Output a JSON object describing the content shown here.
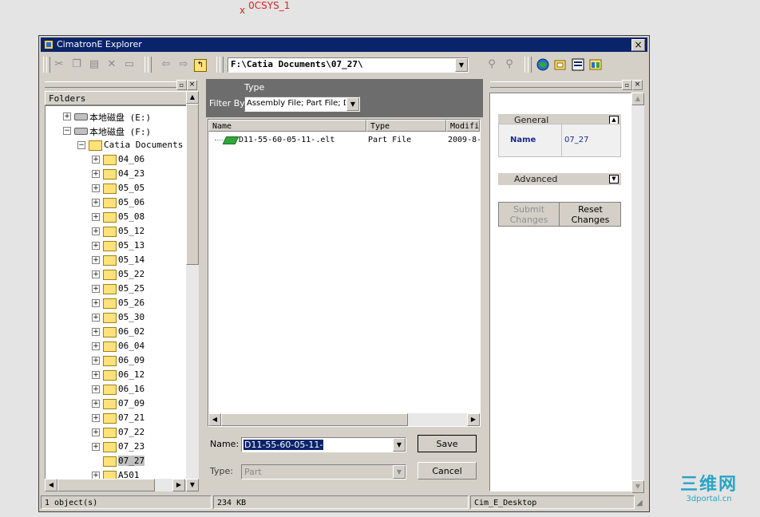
{
  "sketch_label": "0CSYS_1",
  "window": {
    "title": "CimatronE Explorer",
    "close": "×"
  },
  "toolbar": {
    "path": "F:\\Catia Documents\\07_27\\",
    "buttons": [
      "cut-icon",
      "copy-icon",
      "paste-icon",
      "delete-icon",
      "new-folder-icon",
      "back-icon",
      "forward-icon",
      "up-folder-icon",
      "find-icon",
      "find-next-icon",
      "globe-icon",
      "folder-view-icon",
      "properties-icon",
      "layout-icon"
    ]
  },
  "folders": {
    "header": "Folders",
    "items": [
      {
        "label": "本地磁盘 (E:)",
        "expander": "+",
        "type": "drive",
        "depth": 1
      },
      {
        "label": "本地磁盘 (F:)",
        "expander": "−",
        "type": "drive",
        "depth": 1
      },
      {
        "label": "Catia Documents",
        "expander": "−",
        "type": "folder",
        "depth": 2
      },
      {
        "label": "04_06",
        "expander": "+",
        "type": "folder",
        "depth": 3
      },
      {
        "label": "04_23",
        "expander": "+",
        "type": "folder",
        "depth": 3
      },
      {
        "label": "05_05",
        "expander": "+",
        "type": "folder",
        "depth": 3
      },
      {
        "label": "05_06",
        "expander": "+",
        "type": "folder",
        "depth": 3
      },
      {
        "label": "05_08",
        "expander": "+",
        "type": "folder",
        "depth": 3
      },
      {
        "label": "05_12",
        "expander": "+",
        "type": "folder",
        "depth": 3
      },
      {
        "label": "05_13",
        "expander": "+",
        "type": "folder",
        "depth": 3
      },
      {
        "label": "05_14",
        "expander": "+",
        "type": "folder",
        "depth": 3
      },
      {
        "label": "05_22",
        "expander": "+",
        "type": "folder",
        "depth": 3
      },
      {
        "label": "05_25",
        "expander": "+",
        "type": "folder",
        "depth": 3
      },
      {
        "label": "05_26",
        "expander": "+",
        "type": "folder",
        "depth": 3
      },
      {
        "label": "05_30",
        "expander": "+",
        "type": "folder",
        "depth": 3
      },
      {
        "label": "06_02",
        "expander": "+",
        "type": "folder",
        "depth": 3
      },
      {
        "label": "06_04",
        "expander": "+",
        "type": "folder",
        "depth": 3
      },
      {
        "label": "06_09",
        "expander": "+",
        "type": "folder",
        "depth": 3
      },
      {
        "label": "06_12",
        "expander": "+",
        "type": "folder",
        "depth": 3
      },
      {
        "label": "06_16",
        "expander": "+",
        "type": "folder",
        "depth": 3
      },
      {
        "label": "07_09",
        "expander": "+",
        "type": "folder",
        "depth": 3
      },
      {
        "label": "07_21",
        "expander": "+",
        "type": "folder",
        "depth": 3
      },
      {
        "label": "07_22",
        "expander": "+",
        "type": "folder",
        "depth": 3
      },
      {
        "label": "07_23",
        "expander": "+",
        "type": "folder",
        "depth": 3
      },
      {
        "label": "07_27",
        "expander": "",
        "type": "folder",
        "depth": 3,
        "selected": true
      },
      {
        "label": "A501",
        "expander": "+",
        "type": "folder",
        "depth": 3
      }
    ]
  },
  "center": {
    "type_heading": "Type",
    "filter_label": "Filter By:",
    "filter_value": "Assembly File; Part File; Dr",
    "columns": [
      "Name",
      "Type",
      "Modifi"
    ],
    "files": [
      {
        "name": "D11-55-60-05-11-.elt",
        "type": "Part File",
        "modified": "2009-8-"
      }
    ],
    "name_label": "Name:",
    "name_value": "D11-55-60-05-11-",
    "save_label": "Save",
    "type_label": "Type:",
    "type_value": "Part",
    "cancel_label": "Cancel"
  },
  "props": {
    "general_title": "General",
    "name_key": "Name",
    "name_value": "07_27",
    "advanced_title": "Advanced",
    "submit_label": "Submit Changes",
    "reset_label": "Reset Changes"
  },
  "status": {
    "objects": "1 object(s)",
    "size": "234 KB",
    "location": "Cim_E_Desktop"
  },
  "watermark": {
    "big": "三维网",
    "small": "3dportal.cn"
  },
  "colors": {
    "titlebar": "#0a246a",
    "panel_header": "#6d6d6d",
    "selection": "#0a246a",
    "props_text": "#1c2a8c"
  }
}
